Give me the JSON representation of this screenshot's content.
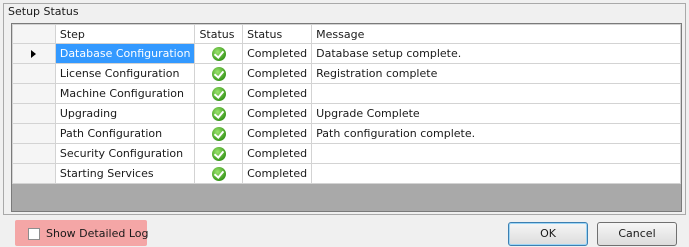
{
  "group": {
    "title": "Setup Status"
  },
  "columns": [
    "Step",
    "Status",
    "Status",
    "Message"
  ],
  "rows": [
    {
      "step": "Database Configuration",
      "status_icon": "green-check-icon",
      "status": "Completed",
      "message": "Database setup complete.",
      "selected": true
    },
    {
      "step": "License Configuration",
      "status_icon": "green-check-icon",
      "status": "Completed",
      "message": "Registration complete"
    },
    {
      "step": "Machine Configuration",
      "status_icon": "green-check-icon",
      "status": "Completed",
      "message": ""
    },
    {
      "step": "Upgrading",
      "status_icon": "green-check-icon",
      "status": "Completed",
      "message": "Upgrade Complete"
    },
    {
      "step": "Path Configuration",
      "status_icon": "green-check-icon",
      "status": "Completed",
      "message": "Path configuration complete."
    },
    {
      "step": "Security Configuration",
      "status_icon": "green-check-icon",
      "status": "Completed",
      "message": ""
    },
    {
      "step": "Starting Services",
      "status_icon": "green-check-icon",
      "status": "Completed",
      "message": ""
    }
  ],
  "footer": {
    "show_log_label": "Show Detailed Log",
    "show_log_checked": false,
    "ok_label": "OK",
    "cancel_label": "Cancel"
  },
  "colors": {
    "selection": "#3399ff",
    "highlight": "#f4a6a6",
    "check": "#3c9a1e"
  }
}
